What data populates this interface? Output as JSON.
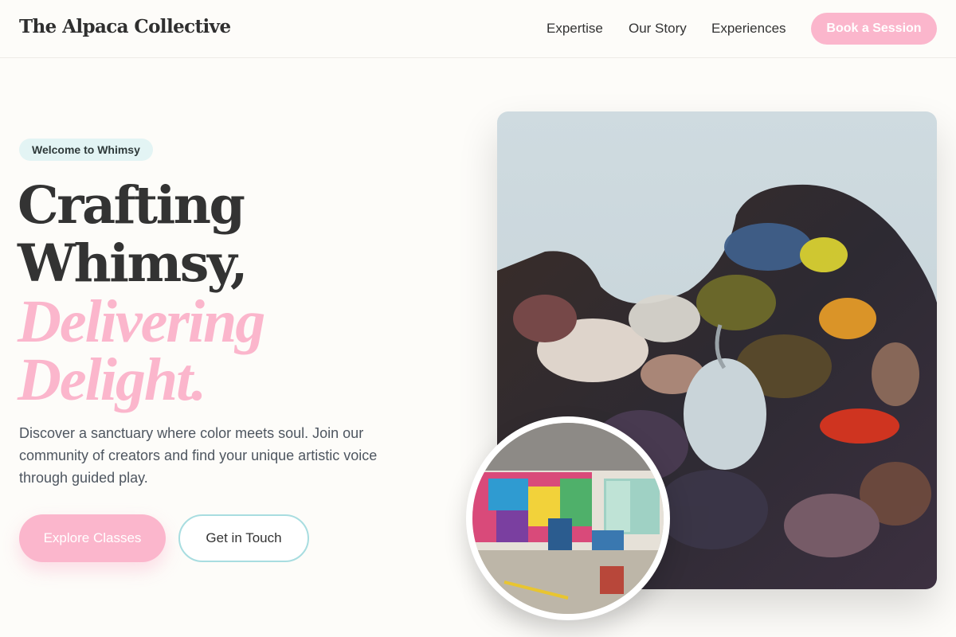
{
  "brand": "The Alpaca Collective",
  "nav": {
    "links": [
      "Expertise",
      "Our Story",
      "Experiences"
    ],
    "cta": "Book a Session"
  },
  "hero": {
    "badge": "Welcome to Whimsy",
    "headline_line1": "Crafting",
    "headline_line2": "Whimsy,",
    "headline_accent1": "Delivering",
    "headline_accent2": "Delight.",
    "description": "Discover a sanctuary where color meets soul. Join our community of creators and find your unique artistic voice through guided play.",
    "primary_button": "Explore Classes",
    "secondary_button": "Get in Touch"
  },
  "colors": {
    "accent_pink": "#fbb6cc",
    "badge_bg": "#e3f4f4",
    "secondary_border": "#a8dde0",
    "page_bg": "#fdfcf9",
    "text_dark": "#333333"
  },
  "images": {
    "main": "paint-palette-photo",
    "circle": "art-studio-photo"
  }
}
